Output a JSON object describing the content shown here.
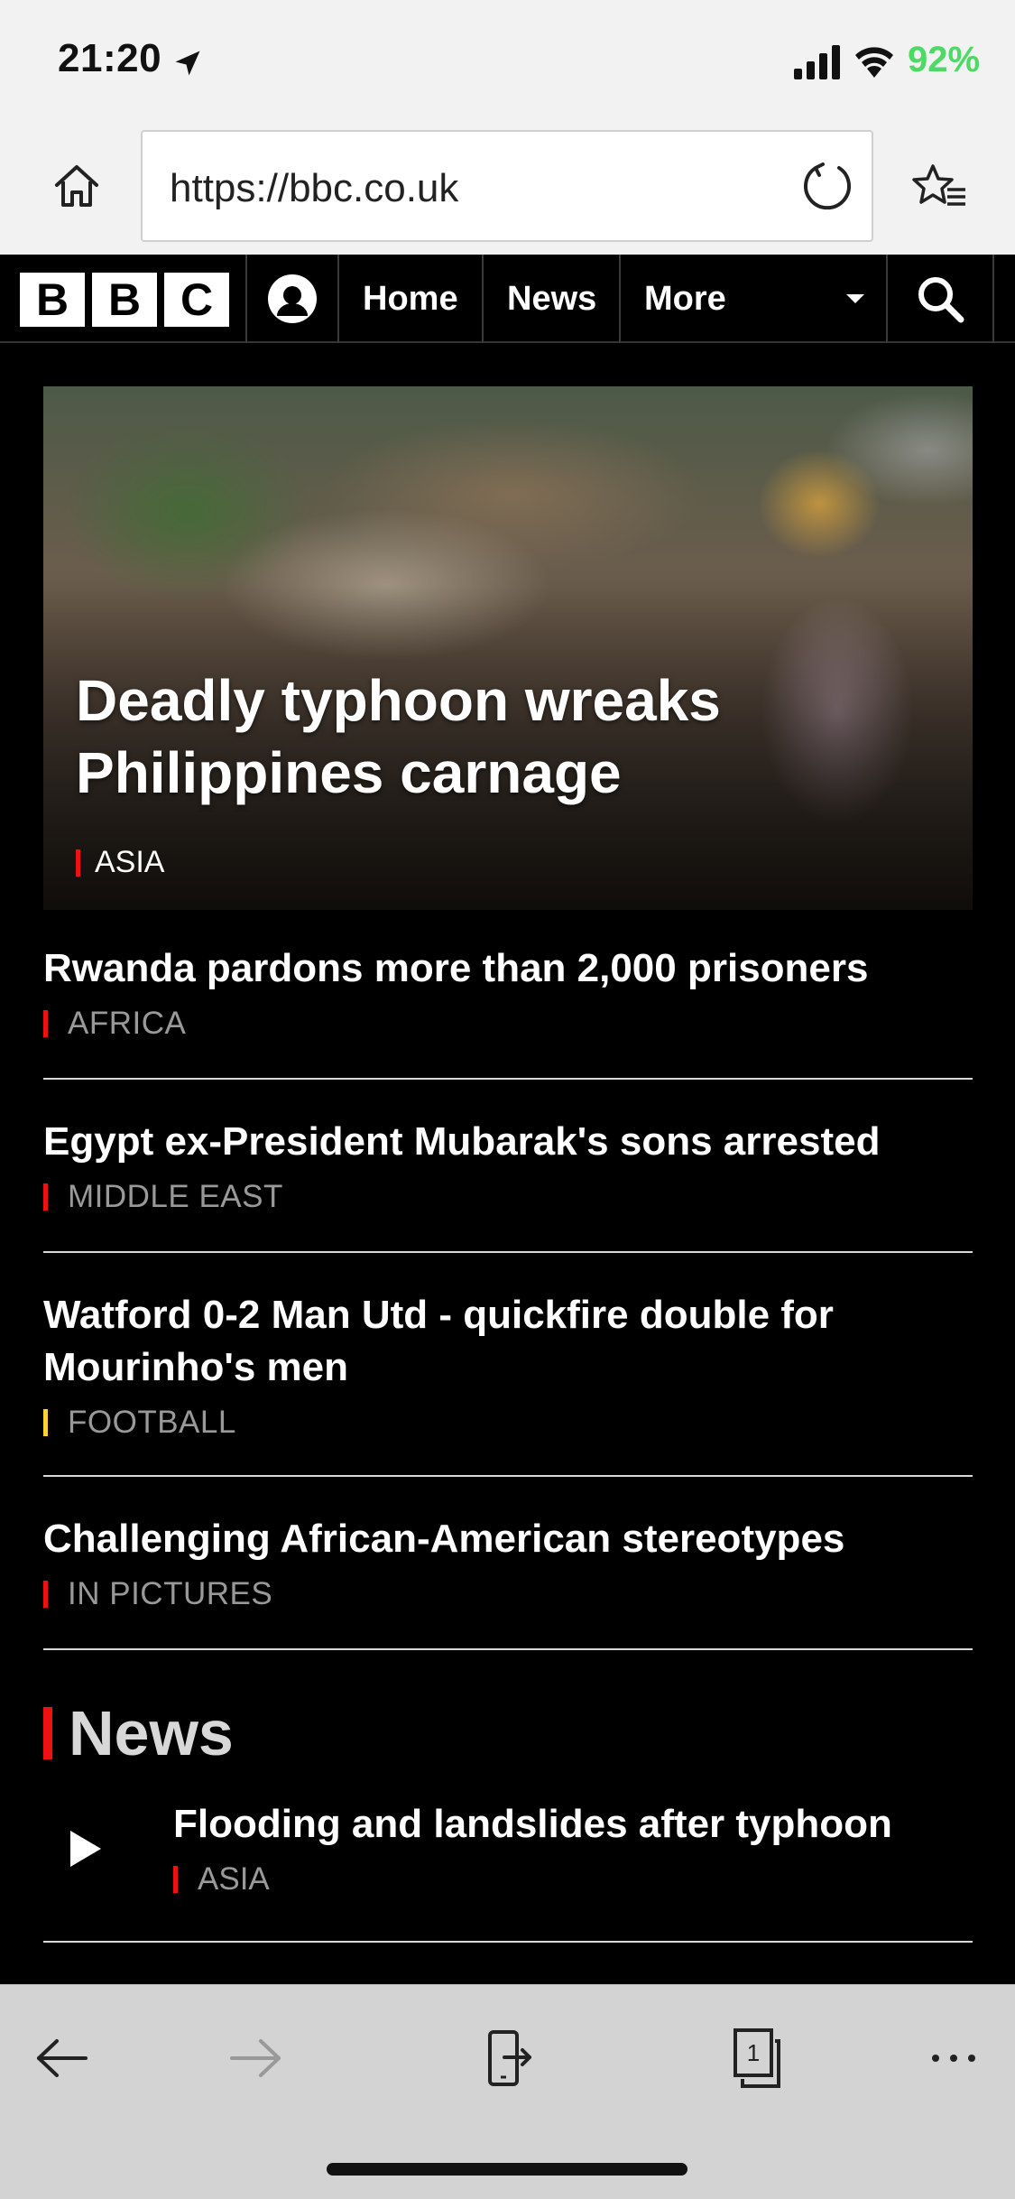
{
  "status_bar": {
    "time": "21:20",
    "battery": "92%",
    "icons": [
      "location-arrow-icon",
      "cellular-signal-icon",
      "wifi-icon"
    ]
  },
  "browser": {
    "url": "https://bbc.co.uk",
    "icons": [
      "home-icon",
      "reload-icon",
      "favorites-icon"
    ]
  },
  "bbc_nav": {
    "logo": [
      "B",
      "B",
      "C"
    ],
    "items": [
      {
        "label": "Home"
      },
      {
        "label": "News"
      },
      {
        "label": "More"
      }
    ],
    "icons": [
      "account-icon",
      "chevron-down-icon",
      "search-icon"
    ]
  },
  "hero": {
    "title": "Deadly typhoon wreaks Philippines carnage",
    "tag": "ASIA",
    "tag_color": "#e11"
  },
  "stories": [
    {
      "title": "Rwanda pardons more than 2,000 prisoners",
      "tag": "AFRICA",
      "tag_color": "#e11"
    },
    {
      "title": "Egypt ex-President Mubarak's sons arrested",
      "tag": "MIDDLE EAST",
      "tag_color": "#e11"
    },
    {
      "title": "Watford 0-2 Man Utd - quickfire double for Mourinho's men",
      "tag": "FOOTBALL",
      "tag_color": "#ffd230"
    },
    {
      "title": "Challenging African-American stereotypes",
      "tag": "IN PICTURES",
      "tag_color": "#e11"
    }
  ],
  "section": {
    "title": "News",
    "items": [
      {
        "title": "Flooding and landslides after typhoon",
        "tag": "ASIA",
        "icon": "play-icon"
      }
    ]
  },
  "toolbar": {
    "icons": [
      "back-arrow-icon",
      "forward-arrow-icon",
      "send-to-device-icon",
      "tabs-icon",
      "more-icon"
    ],
    "tab_count": "1"
  },
  "colors": {
    "accent": "#e11",
    "football": "#ffd230",
    "battery": "#4cd964"
  }
}
